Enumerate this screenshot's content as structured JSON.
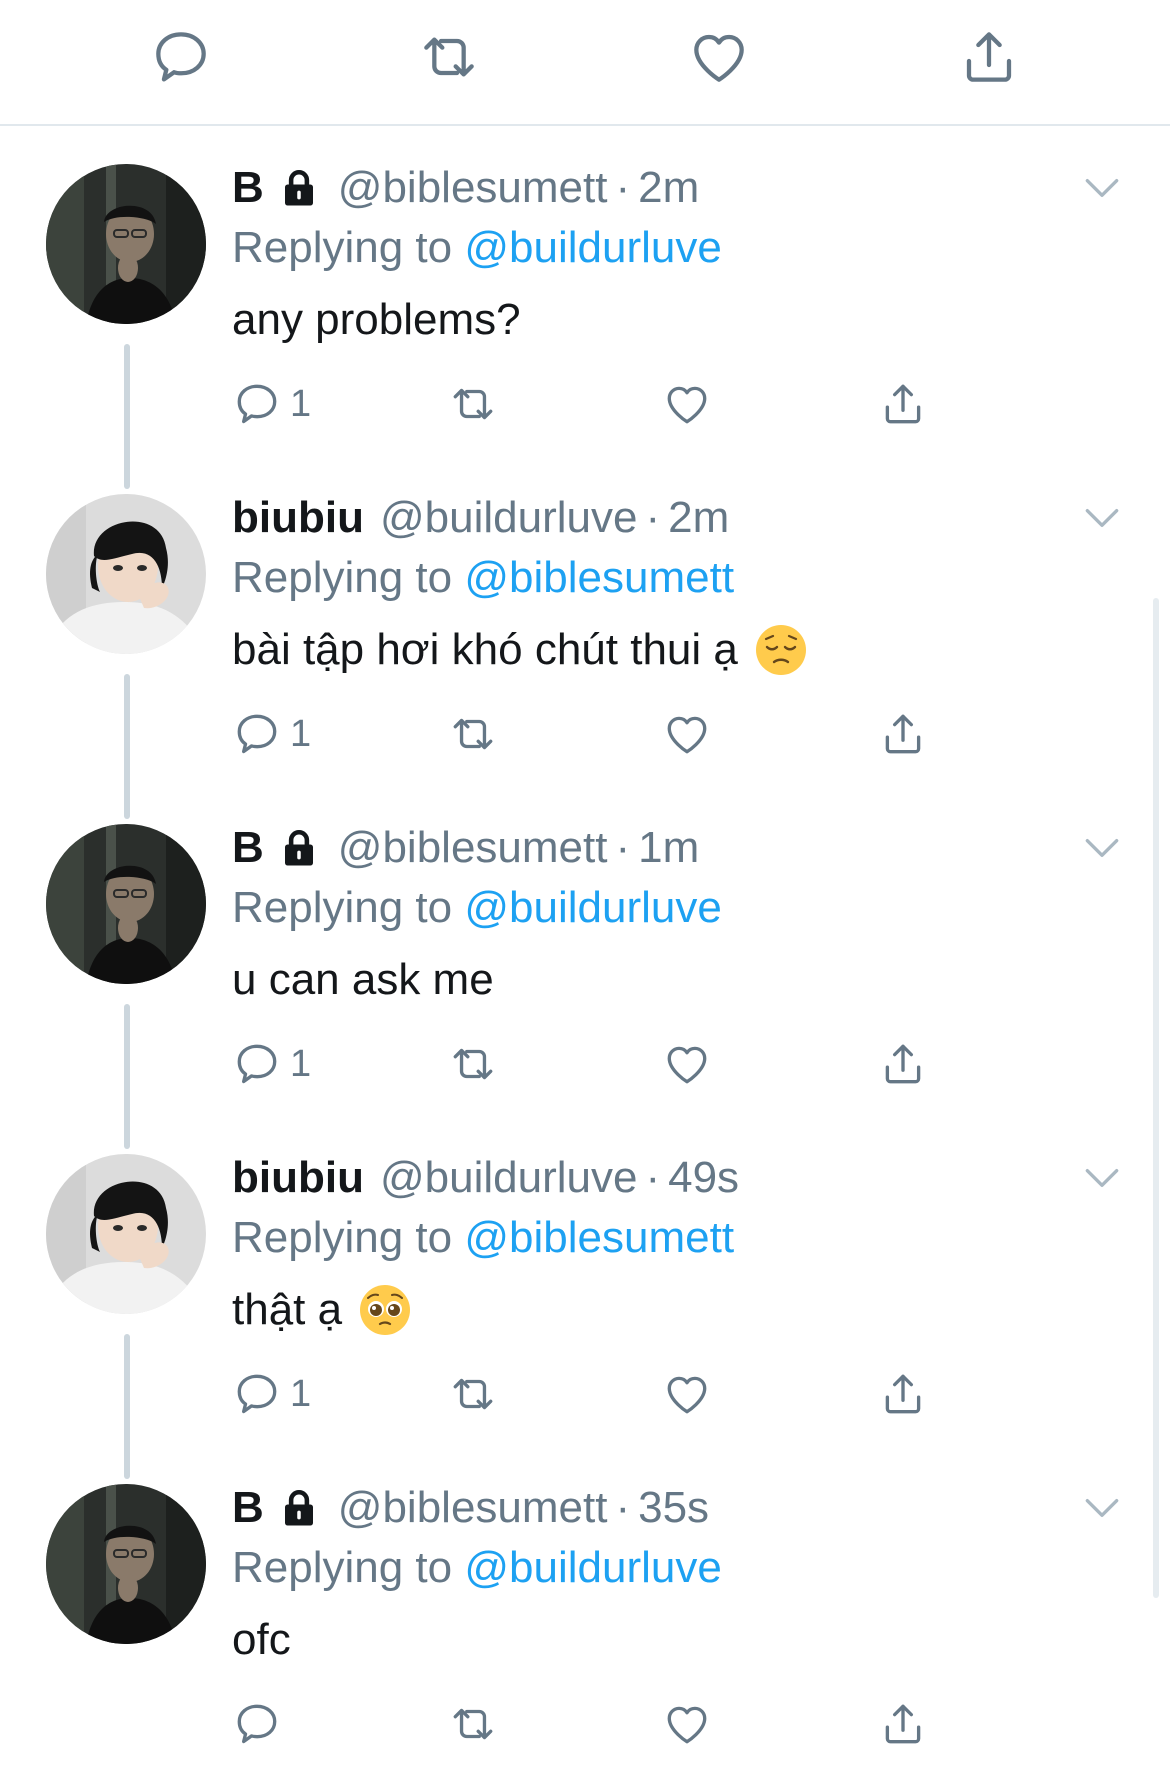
{
  "tweets": [
    {
      "name": "B",
      "locked": true,
      "handle": "@biblesumett",
      "time": "2m",
      "reply_label": "Replying to",
      "reply_to": "@buildurluve",
      "text": "any problems?",
      "emoji": "",
      "reply_count": "1",
      "avatar": "avatar-b"
    },
    {
      "name": "biubiu",
      "locked": false,
      "handle": "@buildurluve",
      "time": "2m",
      "reply_label": "Replying to",
      "reply_to": "@biblesumett",
      "text": "bài tập hơi khó chút thui ạ",
      "emoji": "pensive-face-emoji",
      "reply_count": "1",
      "avatar": "avatar-biubiu"
    },
    {
      "name": "B",
      "locked": true,
      "handle": "@biblesumett",
      "time": "1m",
      "reply_label": "Replying to",
      "reply_to": "@buildurluve",
      "text": "u can ask me",
      "emoji": "",
      "reply_count": "1",
      "avatar": "avatar-b"
    },
    {
      "name": "biubiu",
      "locked": false,
      "handle": "@buildurluve",
      "time": "49s",
      "reply_label": "Replying to",
      "reply_to": "@biblesumett",
      "text": "thật ạ",
      "emoji": "pleading-face-emoji",
      "reply_count": "1",
      "avatar": "avatar-biubiu"
    },
    {
      "name": "B",
      "locked": true,
      "handle": "@biblesumett",
      "time": "35s",
      "reply_label": "Replying to",
      "reply_to": "@buildurluve",
      "text": "ofc",
      "emoji": "",
      "reply_count": "",
      "avatar": "avatar-b"
    }
  ],
  "colors": {
    "link": "#1da1f2",
    "secondary": "#657786",
    "divider": "#e1e8ed",
    "thread_line": "#ccd6dd"
  },
  "icons": [
    "reply-icon",
    "retweet-icon",
    "like-icon",
    "share-icon",
    "lock-icon",
    "chevron-down-icon"
  ]
}
